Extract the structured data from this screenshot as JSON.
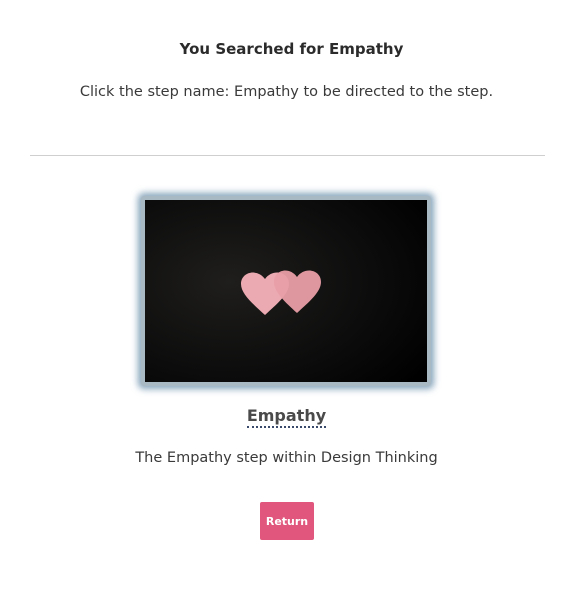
{
  "header": {
    "title": "You Searched for Empathy",
    "instructions": "Click the step name: Empathy to be directed to the step."
  },
  "result": {
    "image_icon": "two-hearts-icon",
    "step_name": "Empathy",
    "description": "The Empathy step within Design Thinking"
  },
  "actions": {
    "return_label": "Return"
  },
  "colors": {
    "button": "#e0567c",
    "heart": "#eba9b1",
    "frame_glow": "#5f87a5",
    "photo_background": "#0a0a0a"
  }
}
